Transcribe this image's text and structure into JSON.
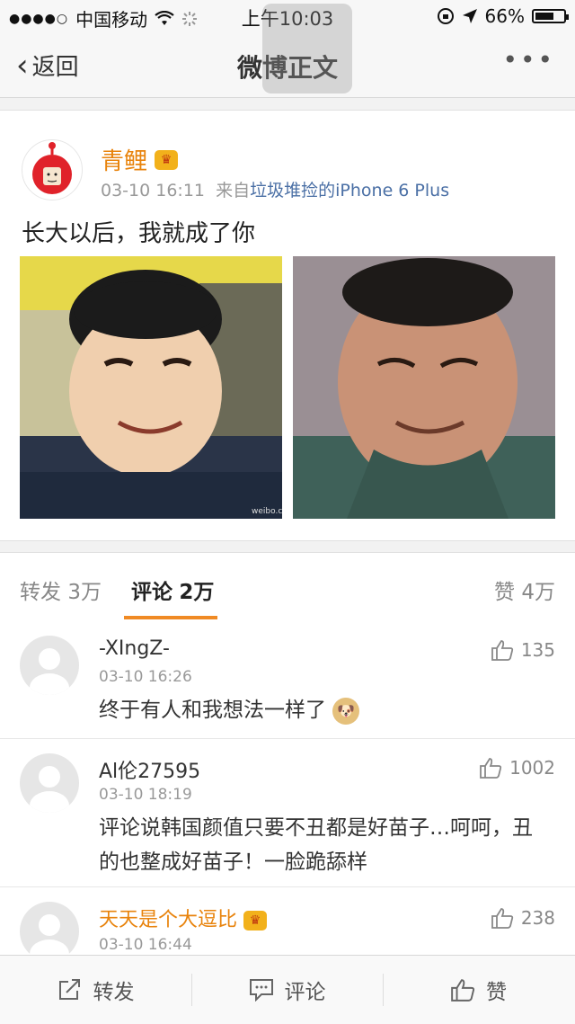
{
  "status_bar": {
    "carrier": "中国移动",
    "time": "上午10:03",
    "battery": "66%",
    "battery_level": 0.66
  },
  "nav": {
    "back_label": "返回",
    "title": "微博正文",
    "more_label": "•••"
  },
  "post": {
    "username": "青鲤",
    "timestamp": "03-10 16:11",
    "source_prefix": "来自",
    "source": "垃圾堆捡的iPhone 6 Plus",
    "text": "长大以后，我就成了你",
    "watermark": "weibo.com"
  },
  "tabs": {
    "repost_label": "转发",
    "repost_count": "3万",
    "comment_label": "评论",
    "comment_count": "2万",
    "like_label": "赞",
    "like_count": "4万"
  },
  "comments": [
    {
      "name": "-XIngZ-",
      "time": "03-10 16:26",
      "text": "终于有人和我想法一样了",
      "likes": "135"
    },
    {
      "name": "Al伦27595",
      "time": "03-10 18:19",
      "text": "评论说韩国颜值只要不丑都是好苗子…呵呵，丑的也整成好苗子！一脸跪舔样",
      "likes": "1002"
    },
    {
      "name": "天天是个大逗比",
      "time": "03-10 16:44",
      "text": "",
      "likes": "238"
    }
  ],
  "toolbar": {
    "repost": "转发",
    "comment": "评论",
    "like": "赞"
  },
  "colors": {
    "accent": "#f08a24",
    "username": "#e8830c",
    "link": "#4a6fa5"
  }
}
